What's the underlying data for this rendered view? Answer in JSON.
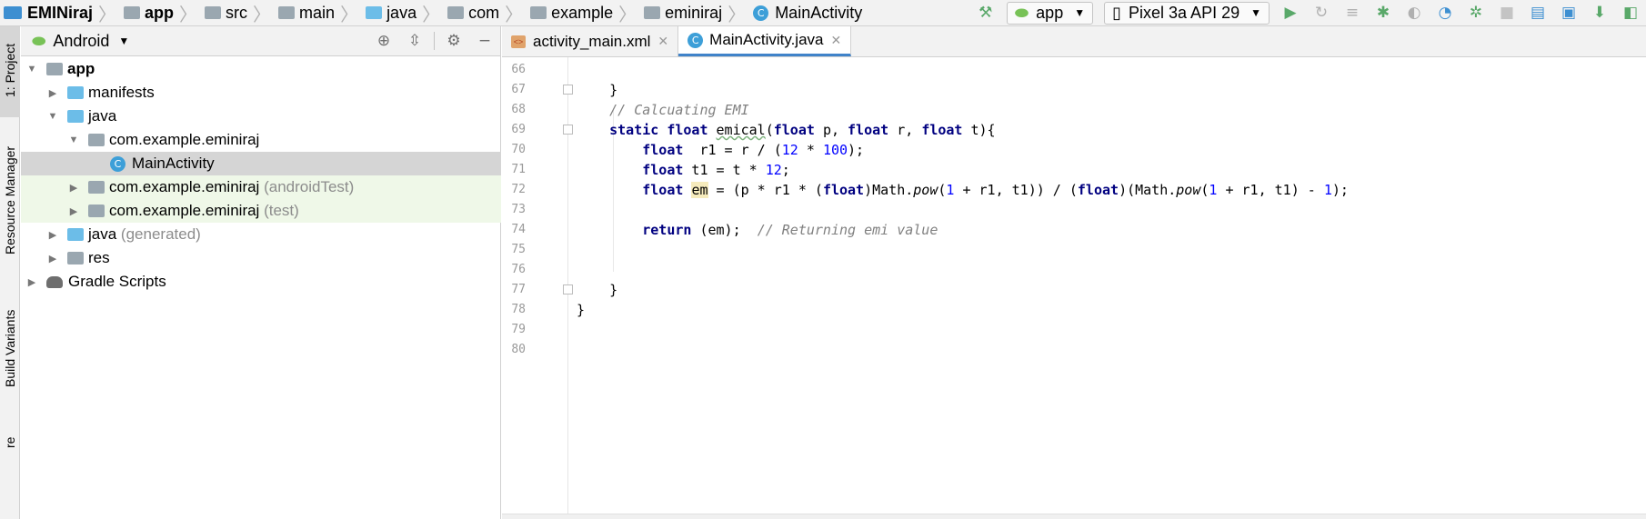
{
  "breadcrumbs": [
    {
      "label": "EMINiraj",
      "icon": "project-icon",
      "bold": true
    },
    {
      "label": "app",
      "icon": "module-folder-icon",
      "bold": true
    },
    {
      "label": "src",
      "icon": "folder-icon"
    },
    {
      "label": "main",
      "icon": "folder-icon"
    },
    {
      "label": "java",
      "icon": "folder-icon"
    },
    {
      "label": "com",
      "icon": "package-icon"
    },
    {
      "label": "example",
      "icon": "package-icon"
    },
    {
      "label": "eminiraj",
      "icon": "package-icon"
    },
    {
      "label": "MainActivity",
      "icon": "class-icon"
    }
  ],
  "toolbar": {
    "run_config": "app",
    "device": "Pixel 3a API 29",
    "colors": {
      "run": "#59a869",
      "debug": "#59a869",
      "accent": "#4083c9"
    }
  },
  "side_stripe": {
    "project_label": "1: Project",
    "resource_manager_label": "Resource Manager",
    "build_variants_label": "Build Variants",
    "bottom_label": "re"
  },
  "project_panel": {
    "view_mode": "Android",
    "tree": [
      {
        "label": "app",
        "bold": true,
        "indent": 0,
        "expanded": true,
        "icon": "module-folder-icon"
      },
      {
        "label": "manifests",
        "indent": 1,
        "expanded": false,
        "icon": "folder-icon"
      },
      {
        "label": "java",
        "indent": 1,
        "expanded": true,
        "icon": "folder-icon"
      },
      {
        "label": "com.example.eminiraj",
        "indent": 2,
        "expanded": true,
        "icon": "package-icon"
      },
      {
        "label": "MainActivity",
        "indent": 3,
        "leaf": true,
        "selected": true,
        "icon": "class-icon"
      },
      {
        "label": "com.example.eminiraj",
        "suffix": "(androidTest)",
        "indent": 2,
        "expanded": false,
        "test": true,
        "icon": "package-icon"
      },
      {
        "label": "com.example.eminiraj",
        "suffix": "(test)",
        "indent": 2,
        "expanded": false,
        "test": true,
        "icon": "package-icon"
      },
      {
        "label": "java",
        "suffix": "(generated)",
        "indent": 1,
        "expanded": false,
        "icon": "generated-folder-icon"
      },
      {
        "label": "res",
        "indent": 1,
        "expanded": false,
        "icon": "res-folder-icon"
      },
      {
        "label": "Gradle Scripts",
        "indent": 0,
        "expanded": false,
        "icon": "gradle-icon"
      }
    ]
  },
  "editor": {
    "tabs": [
      {
        "label": "activity_main.xml",
        "active": false,
        "icon": "xml-icon"
      },
      {
        "label": "MainActivity.java",
        "active": true,
        "icon": "class-icon"
      }
    ],
    "line_numbers": [
      "66",
      "67",
      "68",
      "69",
      "70",
      "71",
      "72",
      "73",
      "74",
      "75",
      "76",
      "77",
      "78",
      "79",
      "80"
    ],
    "lines": {
      "l67": "    }",
      "l68_comment": "// Calcuating EMI",
      "l69": {
        "kw1": "static",
        "kw2": "float",
        "name": "emical",
        "kw3": "float",
        "p": "p,",
        "kw4": "float",
        "r": "r,",
        "kw5": "float",
        "t": "t){"
      },
      "l70": {
        "kw": "float",
        "rest": "  r1 = r / (",
        "n1": "12",
        "mid": " * ",
        "n2": "100",
        "end": ");"
      },
      "l71": {
        "kw": "float",
        "rest": " t1 = t * ",
        "n": "12",
        "end": ";"
      },
      "l72": {
        "kw": "float",
        "var": "em",
        "a": " = (p * r1 * (",
        "kw2": "float",
        "b": ")Math.",
        "pow1": "pow",
        "c": "(",
        "n1": "1",
        "d": " + r1, t1)) / (",
        "kw3": "float",
        "e": ")(Math.",
        "pow2": "pow",
        "f": "(",
        "n2": "1",
        "g": " + r1, t1) - ",
        "n3": "1",
        "h": ");"
      },
      "l74": {
        "kw": "return",
        "rest": " (em);  ",
        "comment": "// Returning emi value"
      },
      "l77": "    }",
      "l78": "}"
    }
  }
}
